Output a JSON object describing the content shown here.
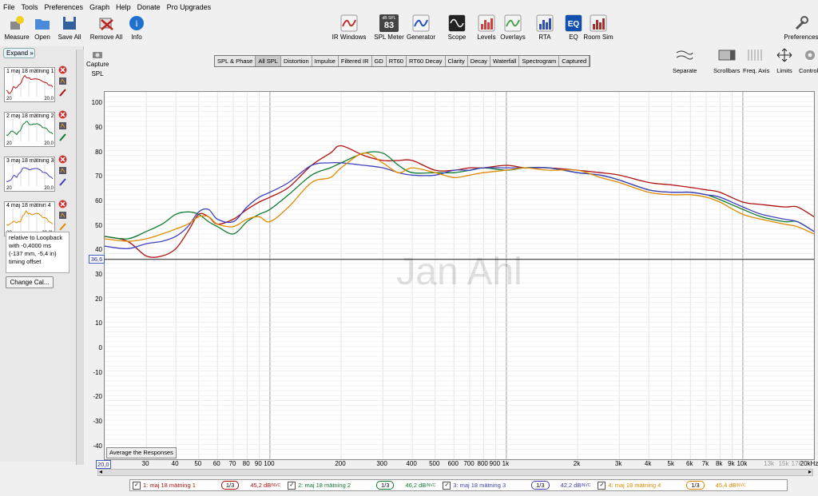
{
  "menu": [
    "File",
    "Tools",
    "Preferences",
    "Graph",
    "Help",
    "Donate",
    "Pro Upgrades"
  ],
  "toolbar_left": [
    {
      "label": "Measure",
      "icon": "microphone-icon"
    },
    {
      "label": "Open",
      "icon": "folder-icon"
    },
    {
      "label": "Save All",
      "icon": "save-icon"
    },
    {
      "label": "Remove All",
      "icon": "remove-icon"
    },
    {
      "label": "Info",
      "icon": "info-icon"
    }
  ],
  "toolbar_center": [
    {
      "label": "IR Windows",
      "icon": "ir-windows-icon"
    },
    {
      "label": "SPL Meter",
      "icon": "spl-meter-icon",
      "small": "dB SPL",
      "value": "83"
    },
    {
      "label": "Generator",
      "icon": "generator-icon"
    },
    {
      "label": "Scope",
      "icon": "scope-icon"
    },
    {
      "label": "Levels",
      "icon": "levels-icon"
    },
    {
      "label": "Overlays",
      "icon": "overlays-icon"
    },
    {
      "label": "RTA",
      "icon": "rta-icon"
    },
    {
      "label": "EQ",
      "icon": "eq-icon"
    },
    {
      "label": "Room Sim",
      "icon": "room-sim-icon"
    }
  ],
  "preferences_label": "Preferences",
  "sidebar": {
    "expand_label": "Expand",
    "measurements": [
      {
        "label": "1 maj 18 mätning 1",
        "color": "#b01010",
        "lo": "20",
        "hi": "20,0"
      },
      {
        "label": "2 maj 18 mätning 2",
        "color": "#107a30",
        "lo": "20",
        "hi": "20,0"
      },
      {
        "label": "3 maj 18 mätning 3",
        "color": "#4040c0",
        "lo": "20",
        "hi": "20,0"
      },
      {
        "label": "4 maj 18 mätnin 4",
        "color": "#e08a00",
        "lo": "20",
        "hi": "20,0k"
      }
    ],
    "note": "relative to Loopback with -0,4000 ms (-137 mm, -5,4 in) timing offset",
    "change_cal_label": "Change Cal..."
  },
  "capture": {
    "label": "Capture",
    "spl": "SPL"
  },
  "tabs": [
    "SPL & Phase",
    "All SPL",
    "Distortion",
    "Impulse",
    "Filtered IR",
    "GD",
    "RT60",
    "RT60 Decay",
    "Clarity",
    "Decay",
    "Waterfall",
    "Spectrogram",
    "Captured"
  ],
  "active_tab": "All SPL",
  "right_controls": [
    {
      "label": "Separate",
      "icon": "separate-icon"
    },
    {
      "label": "Scrollbars",
      "icon": "scrollbars-icon"
    },
    {
      "label": "Freq. Axis",
      "icon": "freq-axis-icon"
    },
    {
      "label": "Limits",
      "icon": "limits-icon"
    },
    {
      "label": "Controls",
      "icon": "controls-icon"
    }
  ],
  "watermark": "Jan Ahl",
  "avg_button": "Average the Responses",
  "cursor_level": "36,6",
  "x_start": "20,0",
  "legend": [
    {
      "name": "1: maj 18 mätning 1",
      "smooth": "1/3",
      "level": "45,2 dB",
      "sup": "INVC",
      "color": "#b01010"
    },
    {
      "name": "2: maj 18 mätning 2",
      "smooth": "1/3",
      "level": "46,2 dB",
      "sup": "INVC",
      "color": "#107a30"
    },
    {
      "name": "3: maj 18 mätning 3",
      "smooth": "1/3",
      "level": "42,2 dB",
      "sup": "INVC",
      "color": "#4040c0"
    },
    {
      "name": "4: maj 18 mätning 4",
      "smooth": "1/3",
      "level": "45,4 dB",
      "sup": "INVC",
      "color": "#e08a00"
    }
  ],
  "chart_data": {
    "type": "line",
    "xlabel": "",
    "ylabel": "",
    "x_scale": "log",
    "xlim": [
      20,
      20000
    ],
    "ylim": [
      -45,
      105
    ],
    "grid": true,
    "y_ticks": [
      100,
      90,
      80,
      70,
      60,
      50,
      40,
      30,
      20,
      10,
      0,
      -10,
      -20,
      -30,
      -40
    ],
    "x_ticks": [
      {
        "v": 30,
        "t": "30"
      },
      {
        "v": 40,
        "t": "40"
      },
      {
        "v": 50,
        "t": "50"
      },
      {
        "v": 60,
        "t": "60"
      },
      {
        "v": 70,
        "t": "70"
      },
      {
        "v": 80,
        "t": "80"
      },
      {
        "v": 90,
        "t": "90"
      },
      {
        "v": 100,
        "t": "100"
      },
      {
        "v": 200,
        "t": "200"
      },
      {
        "v": 300,
        "t": "300"
      },
      {
        "v": 400,
        "t": "400"
      },
      {
        "v": 500,
        "t": "500"
      },
      {
        "v": 600,
        "t": "600"
      },
      {
        "v": 700,
        "t": "700"
      },
      {
        "v": 800,
        "t": "800"
      },
      {
        "v": 900,
        "t": "900"
      },
      {
        "v": 1000,
        "t": "1k"
      },
      {
        "v": 2000,
        "t": "2k"
      },
      {
        "v": 3000,
        "t": "3k"
      },
      {
        "v": 4000,
        "t": "4k"
      },
      {
        "v": 5000,
        "t": "5k"
      },
      {
        "v": 6000,
        "t": "6k"
      },
      {
        "v": 7000,
        "t": "7k"
      },
      {
        "v": 8000,
        "t": "8k"
      },
      {
        "v": 9000,
        "t": "9k"
      },
      {
        "v": 10000,
        "t": "10k"
      },
      {
        "v": 13000,
        "t": "13k"
      },
      {
        "v": 15000,
        "t": "15k"
      },
      {
        "v": 17000,
        "t": "17k"
      },
      {
        "v": 20000,
        "t": "20kHz"
      }
    ],
    "cursor_y": 36.6,
    "x": [
      20,
      25,
      30,
      35,
      40,
      45,
      50,
      55,
      60,
      70,
      80,
      90,
      100,
      120,
      150,
      180,
      200,
      250,
      300,
      350,
      400,
      500,
      600,
      700,
      800,
      1000,
      1200,
      1500,
      2000,
      2500,
      3000,
      4000,
      5000,
      6000,
      7000,
      8000,
      10000,
      12000,
      15000,
      17000,
      20000
    ],
    "series": [
      {
        "name": "1: maj 18 mätning 1",
        "color": "#b01010",
        "values": [
          46,
          44,
          38,
          38,
          41,
          48,
          55,
          54,
          51,
          53,
          57,
          60,
          62,
          66,
          75,
          80,
          83,
          79,
          77,
          77,
          77,
          73,
          73,
          74,
          74,
          75,
          74,
          74,
          73,
          72,
          71,
          68,
          67,
          66,
          65,
          64,
          60,
          59,
          58,
          58,
          54
        ]
      },
      {
        "name": "2: maj 18 mätning 2",
        "color": "#107a30",
        "values": [
          46,
          45,
          48,
          51,
          55,
          56,
          55,
          52,
          50,
          47,
          52,
          55,
          57,
          63,
          71,
          74,
          76,
          80,
          80,
          75,
          72,
          72,
          72,
          73,
          74,
          73,
          74,
          74,
          72,
          71,
          69,
          65,
          64,
          64,
          63,
          61,
          57,
          54,
          52,
          52,
          48
        ]
      },
      {
        "name": "3: maj 18 mätning 3",
        "color": "#4040c0",
        "values": [
          42,
          41,
          43,
          44,
          46,
          50,
          56,
          57,
          53,
          52,
          58,
          62,
          64,
          68,
          75,
          76,
          76,
          75,
          74,
          72,
          71,
          71,
          73,
          73,
          74,
          74,
          74,
          74,
          72,
          71,
          69,
          65,
          64,
          64,
          63,
          62,
          58,
          55,
          53,
          52,
          48
        ]
      },
      {
        "name": "4: maj 18 mätning 4",
        "color": "#e08a00",
        "values": [
          45,
          44,
          45,
          47,
          49,
          51,
          54,
          54,
          51,
          50,
          53,
          54,
          52,
          58,
          68,
          70,
          74,
          80,
          76,
          72,
          74,
          72,
          70,
          71,
          72,
          73,
          74,
          73,
          73,
          70,
          68,
          64,
          63,
          63,
          62,
          60,
          55,
          53,
          51,
          50,
          47
        ]
      }
    ]
  }
}
